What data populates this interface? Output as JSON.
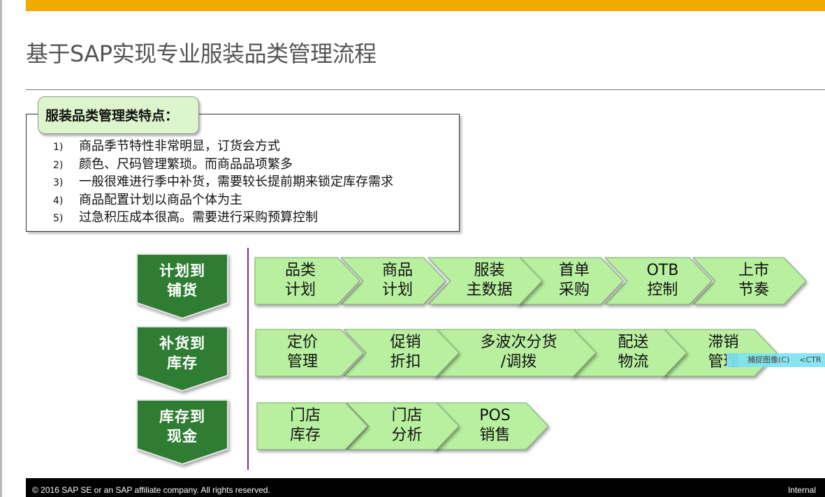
{
  "slide": {
    "title": "基于SAP实现专业服装品类管理流程"
  },
  "features": {
    "heading": "服装品类管理类特点：",
    "items": [
      {
        "num": "1)",
        "text": "商品季节特性非常明显，订货会方式"
      },
      {
        "num": "2)",
        "text": "颜色、尺码管理繁琐。而商品品项繁多"
      },
      {
        "num": "3)",
        "text": "一般很难进行季中补货，需要较长提前期来锁定库存需求"
      },
      {
        "num": "4)",
        "text": "商品配置计划以商品个体为主"
      },
      {
        "num": "5)",
        "text": "过急积压成本很高。需要进行采购预算控制"
      }
    ]
  },
  "stages": [
    {
      "label_line1": "计划到",
      "label_line2": "铺货",
      "steps": [
        {
          "line1": "品类",
          "line2": "计划"
        },
        {
          "line1": "商品",
          "line2": "计划"
        },
        {
          "line1": "服装",
          "line2": "主数据"
        },
        {
          "line1": "首单",
          "line2": "采购"
        },
        {
          "line1": "OTB",
          "line2": "控制"
        },
        {
          "line1": "上市",
          "line2": "节奏"
        }
      ]
    },
    {
      "label_line1": "补货到",
      "label_line2": "库存",
      "steps": [
        {
          "line1": "定价",
          "line2": "管理"
        },
        {
          "line1": "促销",
          "line2": "折扣"
        },
        {
          "line1": "多波次分货",
          "line2": "/调拨"
        },
        {
          "line1": "配送",
          "line2": "物流"
        },
        {
          "line1": "滞销",
          "line2": "管理"
        }
      ]
    },
    {
      "label_line1": "库存到",
      "label_line2": "现金",
      "steps": [
        {
          "line1": "门店",
          "line2": "库存"
        },
        {
          "line1": "门店",
          "line2": "分析"
        },
        {
          "line1": "POS",
          "line2": "销售"
        }
      ]
    }
  ],
  "overlay": {
    "capture_label": "捕捉图像(C)",
    "capture_shortcut": "<CTR"
  },
  "footer": {
    "copyright": "© 2016 SAP SE or an SAP  affiliate company. All rights reserved.",
    "classification": "Internal"
  },
  "colors": {
    "top_bar": "#f0ab00",
    "stage_green": "#2e7d32",
    "chevron_fill": "#b8f0a0",
    "divider_purple": "#8a2a8a"
  }
}
